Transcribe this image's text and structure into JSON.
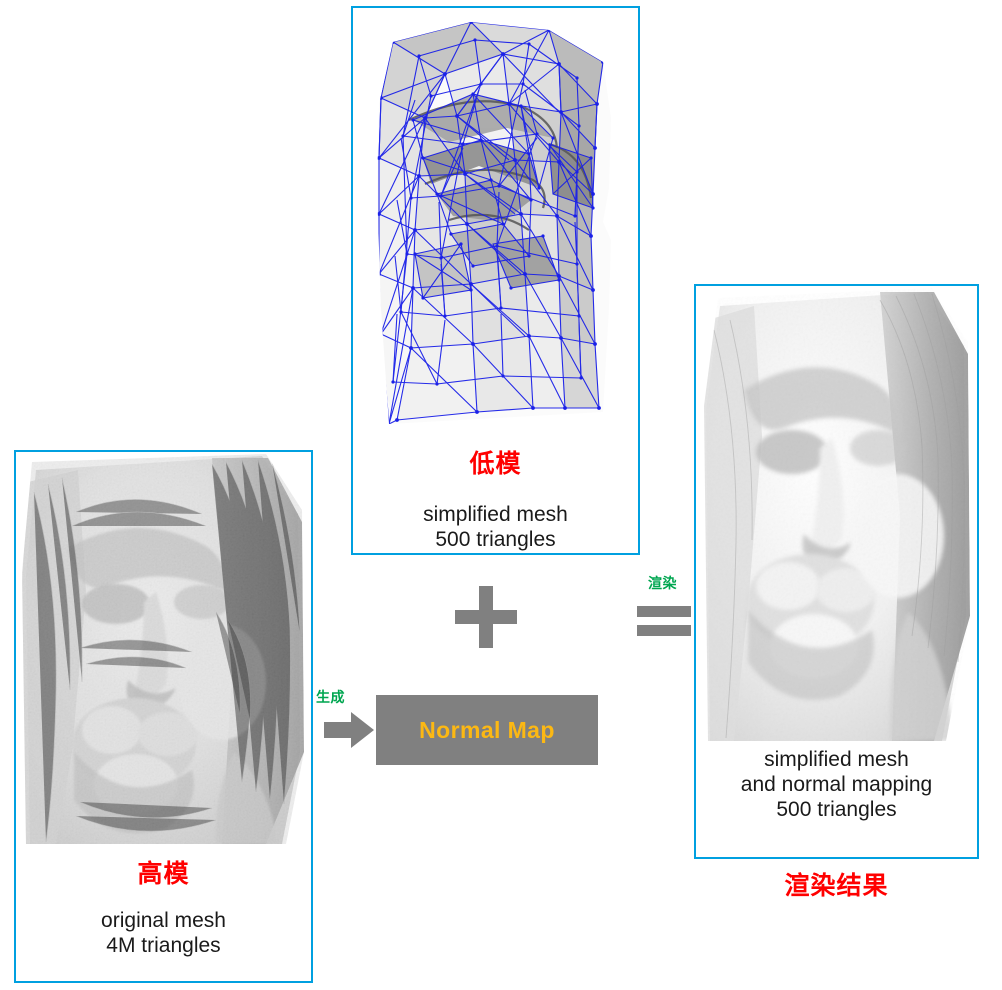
{
  "panels": {
    "high_poly": {
      "cn_label": "高模",
      "caption": "original mesh\n4M triangles",
      "border_color": "#00a0e0"
    },
    "low_poly": {
      "cn_label": "低模",
      "caption": "simplified mesh\n500 triangles",
      "border_color": "#00a0e0",
      "wireframe_color": "#1a20e8"
    },
    "render_result": {
      "cn_label": "渲染结果",
      "caption": "simplified mesh\nand normal mapping\n500 triangles",
      "border_color": "#00a0e0"
    }
  },
  "normal_map": {
    "label": "Normal Map",
    "background_color": "#808080",
    "text_color": "#fcb813"
  },
  "operators": {
    "plus": "+",
    "equals": "=",
    "color": "#808080"
  },
  "annotations": {
    "generate": "生成",
    "render": "渲染",
    "color": "#00a650"
  },
  "icons": {
    "arrow_right": "arrow-right-icon",
    "plus": "plus-icon",
    "equals": "equals-icon"
  }
}
